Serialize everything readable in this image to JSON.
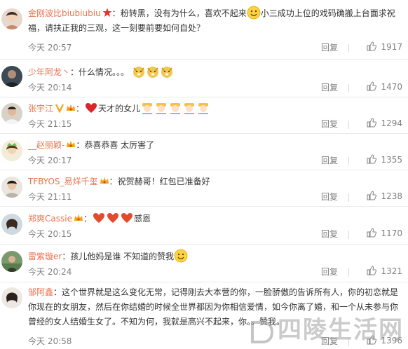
{
  "comments": [
    {
      "user": "金刚波比biubiubiu",
      "text_before": "粉转黑，没有为什么，喜欢不起来",
      "text_after": "小三成功上位的戏码确搬上台面求祝福，请扶正我的三观，这一刻要前要如何自处？",
      "time": "今天 20:57",
      "reply": "回复",
      "likes": "1917"
    },
    {
      "user": "少年阿龙丶",
      "text": "什么情况。。。",
      "time": "今天 20:14",
      "reply": "回复",
      "likes": "1470"
    },
    {
      "user": "张宇江",
      "text": "天才的女儿",
      "time": "今天 21:15",
      "reply": "回复",
      "likes": "1294"
    },
    {
      "user": "__赵丽颖-",
      "text": "恭喜恭喜 太厉害了",
      "time": "今天 20:17",
      "reply": "回复",
      "likes": "1355"
    },
    {
      "user": "TFBYOS_易烊千玺",
      "text": "祝贺赫哥！红包已准备好",
      "time": "今天 21:11",
      "reply": "回复",
      "likes": "1238"
    },
    {
      "user": "郑爽Cassie",
      "text": "感恩",
      "time": "今天 20:15",
      "reply": "回复",
      "likes": "1170"
    },
    {
      "user": "雷紫璇er",
      "text": "孩儿他妈是谁 不知道的赞我",
      "time": "今天 20:24",
      "reply": "回复",
      "likes": "1321"
    },
    {
      "user": "邹阿鑫",
      "text": "这个世界就是这么变化无常，记得刚去大本营的你，一脸骄傲的告诉所有人，你的初恋就是你现在的女朋友，然后在你结婚的时候全世界都因为你相信爱情，如今你离了婚，和一个从未参与你曾经的女人结婚生女了。不知为何，我就是高兴不起来，你。。赞我。",
      "time": "今天 20:58",
      "reply": "回复",
      "likes": "1396"
    }
  ],
  "watermark": "四陵生活网",
  "colors": {
    "username": "#eb7350",
    "meta": "#808080",
    "divider": "#eaeaea"
  }
}
